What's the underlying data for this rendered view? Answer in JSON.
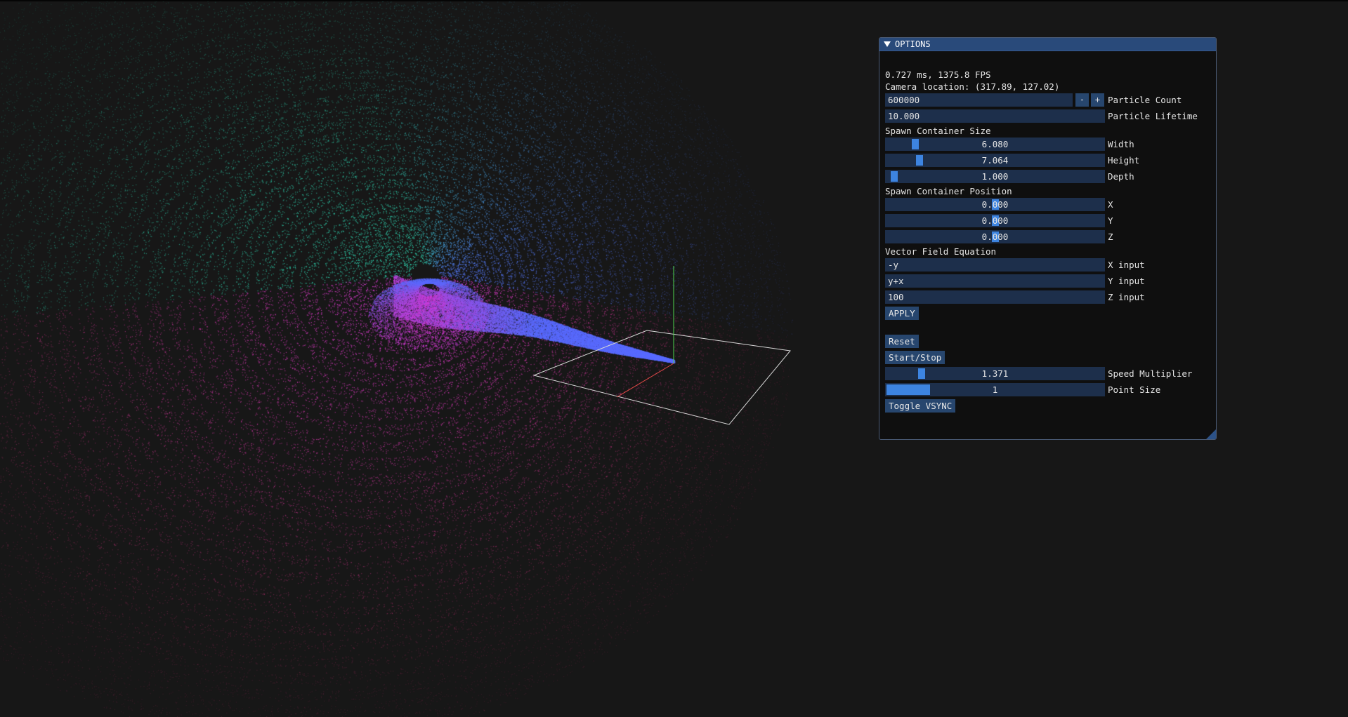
{
  "window": {
    "title": "OPTIONS",
    "stats": "0.727 ms, 1375.8 FPS",
    "camera": "Camera location: (317.89, 127.02)"
  },
  "particle_count": {
    "value": "600000",
    "label": "Particle Count",
    "minus": "-",
    "plus": "+"
  },
  "particle_lifetime": {
    "value": "10.000",
    "label": "Particle Lifetime"
  },
  "spawn_size": {
    "header": "Spawn Container Size",
    "width": {
      "value": "6.080",
      "label": "Width",
      "fraction": 0.12
    },
    "height": {
      "value": "7.064",
      "label": "Height",
      "fraction": 0.14
    },
    "depth": {
      "value": "1.000",
      "label": "Depth",
      "fraction": 0.02
    }
  },
  "spawn_position": {
    "header": "Spawn Container Position",
    "x": {
      "value": "0.000",
      "label": "X",
      "fraction": 0.5
    },
    "y": {
      "value": "0.000",
      "label": "Y",
      "fraction": 0.5
    },
    "z": {
      "value": "0.000",
      "label": "Z",
      "fraction": 0.5
    }
  },
  "vector_field": {
    "header": "Vector Field Equation",
    "x": {
      "value": "-y",
      "label": "X input"
    },
    "y": {
      "value": "y+x",
      "label": "Y input"
    },
    "z": {
      "value": "100",
      "label": "Z input"
    },
    "apply": "APPLY"
  },
  "controls": {
    "reset": "Reset",
    "start_stop": "Start/Stop",
    "speed": {
      "value": "1.371",
      "label": "Speed Multiplier",
      "fraction": 0.15
    },
    "point_size": {
      "value": "1",
      "label": "Point Size",
      "fraction": 0.2
    },
    "vsync": "Toggle VSYNC"
  },
  "colors": {
    "frame_bg": "#1d2f4b",
    "grab": "#3d84e0",
    "button": "#27466e",
    "title_bg": "#294a7a",
    "particle_teal": "#2fc9a8",
    "particle_blue": "#5a6cff",
    "particle_magenta": "#d33ad8",
    "particle_pink": "#e23a80"
  }
}
